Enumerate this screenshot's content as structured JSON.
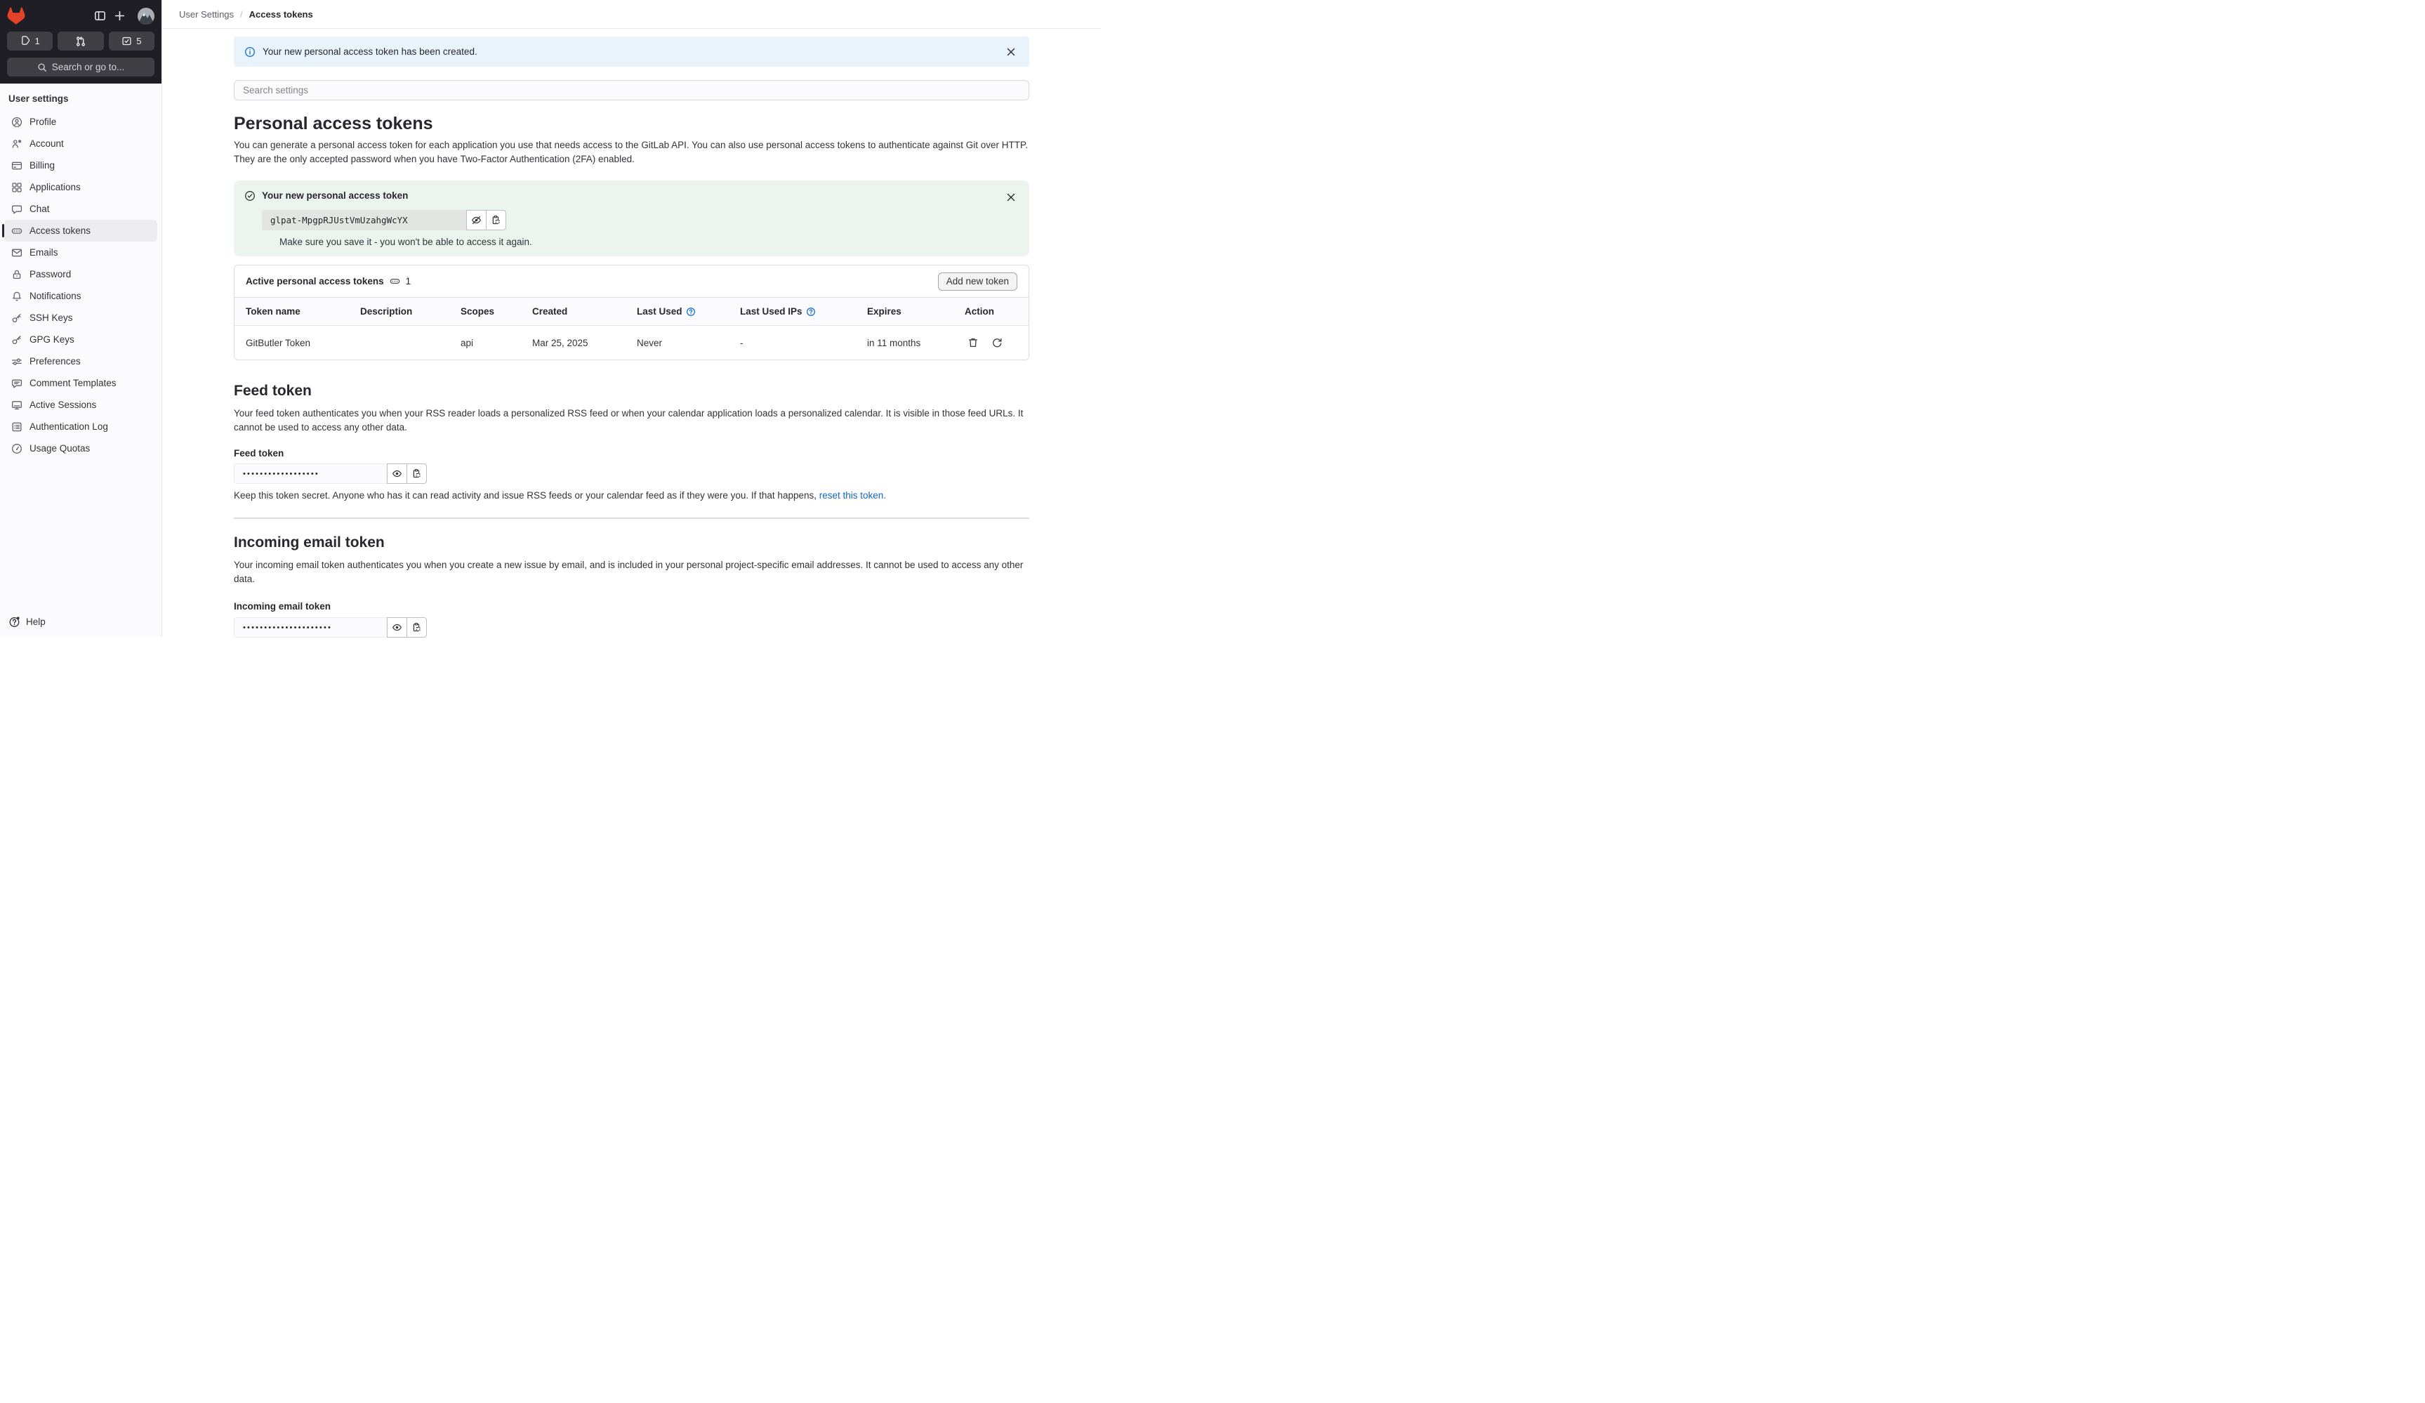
{
  "colors": {
    "brand_orange": "#e24329",
    "superbar_bg": "#1f1e24",
    "sidebar_bg": "#fbfafd",
    "active_item_bg": "#ececef",
    "alert_info_bg": "#e9f3fc",
    "info_icon_blue": "#1f75cb",
    "success_panel_bg": "#ecf4ee",
    "link_blue": "#1068bf"
  },
  "topbar": {
    "issues_count": "1",
    "todos_count": "5",
    "search_label": "Search or go to...",
    "icons": [
      "gitlab-logo-icon",
      "sidebar-toggle-icon",
      "plus-icon",
      "avatar",
      "issues-icon",
      "merge-request-icon",
      "todos-icon",
      "search-icon"
    ]
  },
  "sidebar": {
    "title": "User settings",
    "items": [
      {
        "label": "Profile",
        "icon": "user-icon"
      },
      {
        "label": "Account",
        "icon": "account-icon"
      },
      {
        "label": "Billing",
        "icon": "credit-card-icon"
      },
      {
        "label": "Applications",
        "icon": "grid-icon"
      },
      {
        "label": "Chat",
        "icon": "chat-icon"
      },
      {
        "label": "Access tokens",
        "icon": "token-icon",
        "active": true
      },
      {
        "label": "Emails",
        "icon": "mail-icon"
      },
      {
        "label": "Password",
        "icon": "lock-icon"
      },
      {
        "label": "Notifications",
        "icon": "bell-icon"
      },
      {
        "label": "SSH Keys",
        "icon": "key-icon"
      },
      {
        "label": "GPG Keys",
        "icon": "key-icon"
      },
      {
        "label": "Preferences",
        "icon": "sliders-icon"
      },
      {
        "label": "Comment Templates",
        "icon": "comment-lines-icon"
      },
      {
        "label": "Active Sessions",
        "icon": "monitor-icon"
      },
      {
        "label": "Authentication Log",
        "icon": "log-icon"
      },
      {
        "label": "Usage Quotas",
        "icon": "gauge-icon"
      }
    ],
    "help_label": "Help"
  },
  "breadcrumb": {
    "parent": "User Settings",
    "separator": "/",
    "current": "Access tokens"
  },
  "alert": {
    "text": "Your new personal access token has been created."
  },
  "settings_search": {
    "placeholder": "Search settings"
  },
  "pat": {
    "title": "Personal access tokens",
    "description": "You can generate a personal access token for each application you use that needs access to the GitLab API. You can also use personal access tokens to authenticate against Git over HTTP. They are the only accepted password when you have Two-Factor Authentication (2FA) enabled.",
    "new_token_panel": {
      "title": "Your new personal access token",
      "token_value": "glpat-MpgpRJUstVmUzahgWcYX",
      "note": "Make sure you save it - you won't be able to access it again."
    },
    "card": {
      "title": "Active personal access tokens",
      "count": "1",
      "add_button": "Add new token"
    },
    "table": {
      "columns": [
        "Token name",
        "Description",
        "Scopes",
        "Created",
        "Last Used",
        "Last Used IPs",
        "Expires",
        "Action"
      ],
      "row": {
        "name": "GitButler Token",
        "description": "",
        "scopes": "api",
        "created": "Mar 25, 2025",
        "last_used": "Never",
        "last_used_ips": "-",
        "expires": "in 11 months"
      }
    }
  },
  "feed_token": {
    "title": "Feed token",
    "description": "Your feed token authenticates you when your RSS reader loads a personalized RSS feed or when your calendar application loads a personalized calendar. It is visible in those feed URLs. It cannot be used to access any other data.",
    "label": "Feed token",
    "masked_value": "••••••••••••••••••",
    "note_prefix": "Keep this token secret. Anyone who has it can read activity and issue RSS feeds or your calendar feed as if they were you. If that happens, ",
    "reset_link": "reset this token."
  },
  "incoming_email_token": {
    "title": "Incoming email token",
    "description": "Your incoming email token authenticates you when you create a new issue by email, and is included in your personal project-specific email addresses. It cannot be used to access any other data.",
    "label": "Incoming email token",
    "masked_value": "•••••••••••••••••••••"
  }
}
